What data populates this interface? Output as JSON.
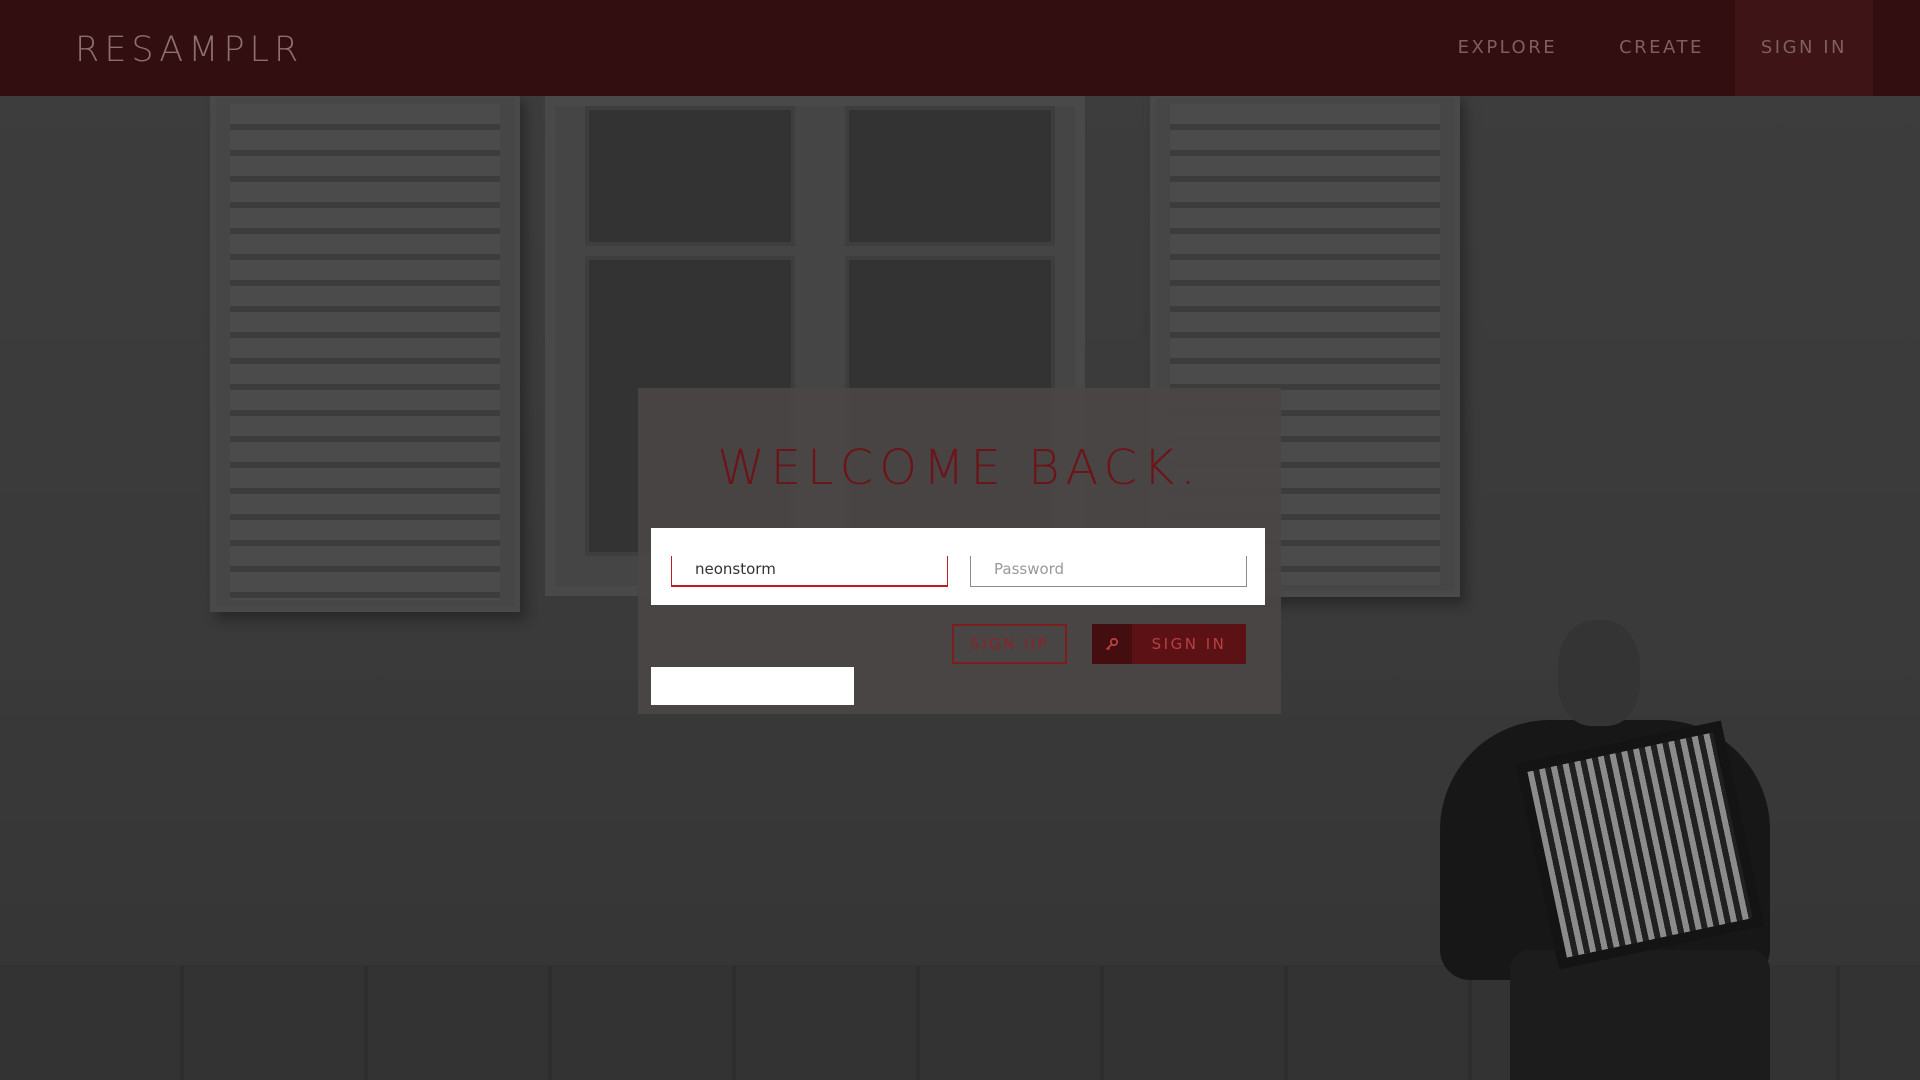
{
  "header": {
    "brand": "RESAMPLR",
    "nav": [
      {
        "label": "EXPLORE"
      },
      {
        "label": "CREATE"
      },
      {
        "label": "SIGN IN",
        "active": true
      }
    ]
  },
  "login": {
    "title": "WELCOME BACK.",
    "username_value": "neonstorm",
    "password_placeholder": "Password",
    "signup_label": "SIGN UP",
    "signin_label": "SIGN IN",
    "signin_icon": "key-icon"
  },
  "colors": {
    "header_bg": "#330e10",
    "accent": "#6c1418",
    "active_field_border": "#c21b22"
  }
}
